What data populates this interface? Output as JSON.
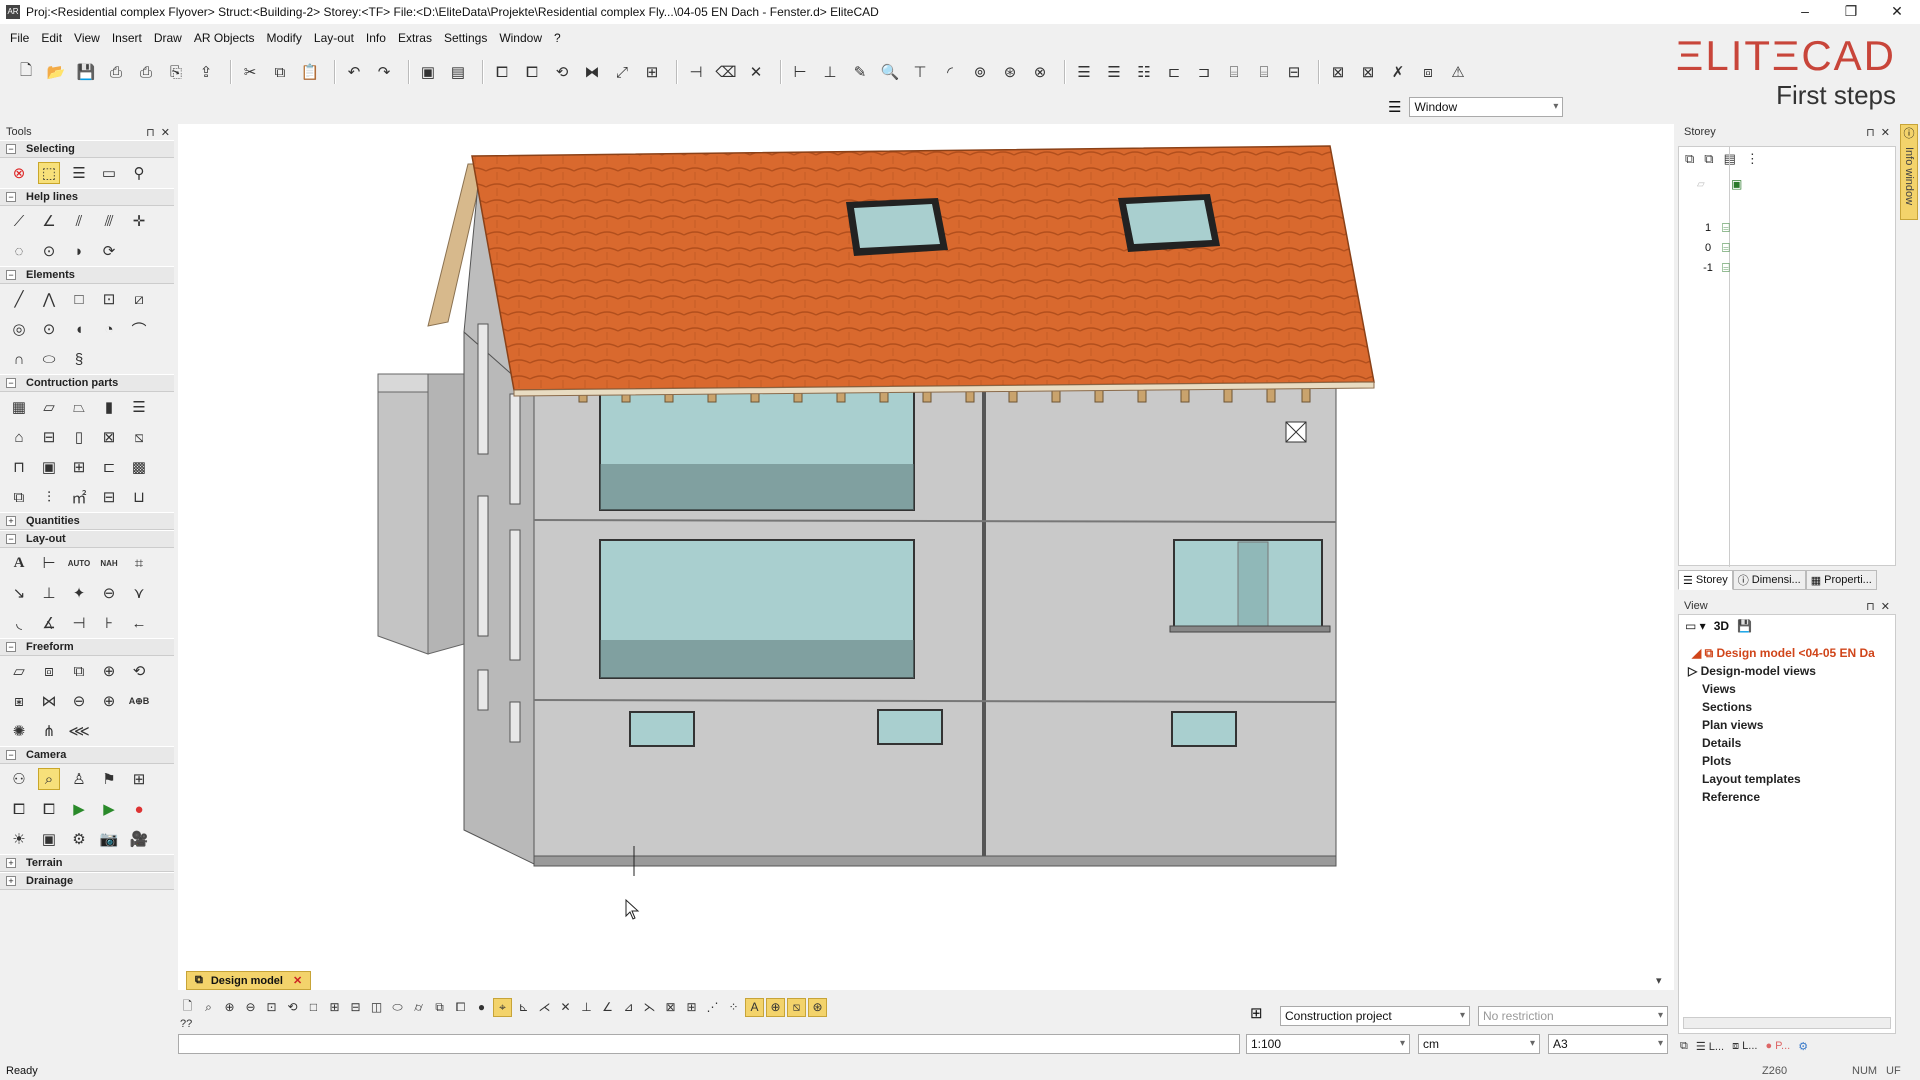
{
  "window": {
    "title": "Proj:<Residential complex Flyover> Struct:<Building-2> Storey:<TF> File:<D:\\EliteData\\Projekte\\Residential complex Fly...\\04-05 EN Dach - Fenster.d> EliteCAD",
    "app_icon": "AR",
    "minimize": "–",
    "maximize": "❐",
    "close": "✕"
  },
  "menu": [
    "File",
    "Edit",
    "View",
    "Insert",
    "Draw",
    "AR Objects",
    "Modify",
    "Lay-out",
    "Info",
    "Extras",
    "Settings",
    "Window",
    "?"
  ],
  "brand": {
    "logo": "ΞLITΞCAD",
    "subtitle": "First steps",
    "logo_color": "#c8453a"
  },
  "view_selector": {
    "value": "Window"
  },
  "tools_panel": {
    "title": "Tools",
    "pin": "⊓",
    "close": "✕",
    "sections": [
      {
        "label": "Selecting",
        "sign": "−"
      },
      {
        "label": "Help lines",
        "sign": "−"
      },
      {
        "label": "Elements",
        "sign": "−"
      },
      {
        "label": "Contruction parts",
        "sign": "−"
      },
      {
        "label": "Quantities",
        "sign": "+"
      },
      {
        "label": "Lay-out",
        "sign": "−"
      },
      {
        "label": "Freeform",
        "sign": "−"
      },
      {
        "label": "Camera",
        "sign": "−"
      },
      {
        "label": "Terrain",
        "sign": "+"
      },
      {
        "label": "Drainage",
        "sign": "+"
      }
    ]
  },
  "viewport": {
    "tab_label": "Design model",
    "tab_close": "✕",
    "prompt": "??",
    "scroll_arrow": "▾"
  },
  "bottom_fields": {
    "project": "Construction project",
    "restriction": "No restriction",
    "scale": "1:100",
    "unit": "cm",
    "paper": "A3"
  },
  "storey_panel": {
    "title": "Storey",
    "levels": [
      "1",
      "0",
      "-1"
    ],
    "tabs": [
      "Storey",
      "Dimensi...",
      "Properti..."
    ]
  },
  "view_panel": {
    "title": "View",
    "mode": "3D",
    "root": "Design model <04-05 EN Da",
    "items": [
      "Design-model views",
      "Views",
      "Sections",
      "Plan views",
      "Details",
      "Plots",
      "Layout templates",
      "Reference"
    ]
  },
  "info_window": {
    "label": "Info window"
  },
  "status": {
    "left": "Ready",
    "coord": "Z260",
    "num": "NUM",
    "uf": "UF"
  },
  "bottom_icons": [
    "L...",
    "L...",
    "P..."
  ],
  "colors": {
    "roof": "#d9692e",
    "wall": "#c9c9c9",
    "glass": "#a9cfcf",
    "highlight": "#f3d36b"
  }
}
